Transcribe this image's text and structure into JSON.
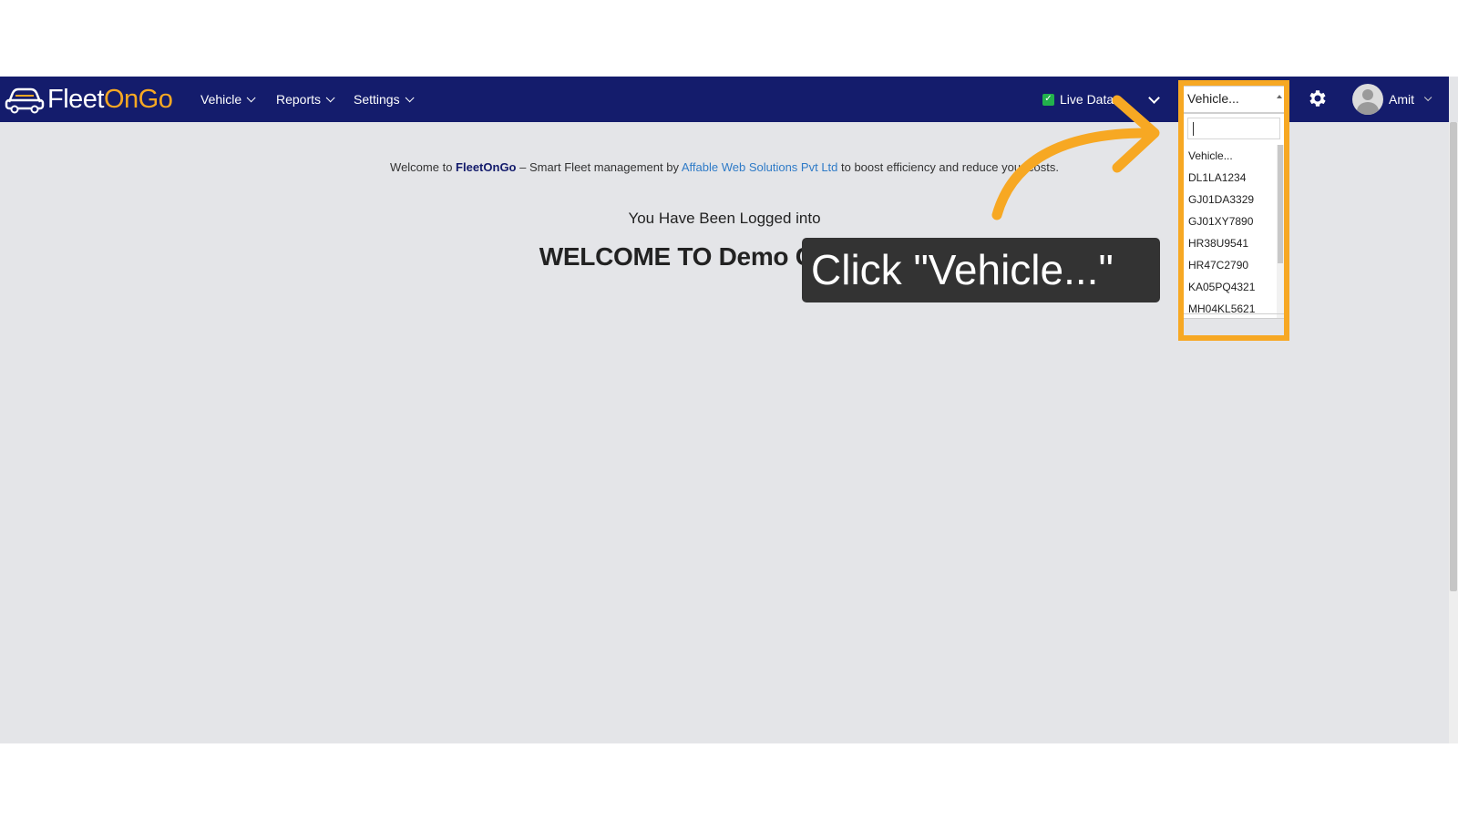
{
  "brand": {
    "name_part1": "Fleet",
    "name_part2": "OnGo",
    "logo_icon": "car-icon"
  },
  "nav": {
    "menus": [
      {
        "label": "Vehicle"
      },
      {
        "label": "Reports"
      },
      {
        "label": "Settings"
      }
    ],
    "live_data": {
      "label": "Live Data",
      "checked": true
    },
    "vehicle_select": {
      "value": "Vehicle...",
      "search_value": "",
      "options": [
        "Vehicle...",
        "DL1LA1234",
        "GJ01DA3329",
        "GJ01XY7890",
        "HR38U9541",
        "HR47C2790",
        "KA05PQ4321",
        "MH04KL5621"
      ]
    },
    "settings_icon": "gear-icon",
    "user": {
      "name": "Amit",
      "avatar_icon": "user-avatar-icon"
    }
  },
  "main": {
    "welcome": {
      "prefix": "Welcome to ",
      "brand": "FleetOnGo",
      "middle": " – Smart Fleet management by ",
      "company": "Affable Web Solutions Pvt Ltd",
      "suffix": " to boost efficiency and reduce your costs."
    },
    "logged_in_text": "You Have Been Logged into",
    "company_title": "WELCOME TO Demo Company"
  },
  "overlay": {
    "instruction": "Click \"Vehicle...\"",
    "highlight_color": "#f7a823",
    "arrow_color": "#f7a823"
  },
  "colors": {
    "navbar": "#141c6c",
    "accent": "#f7a823",
    "link": "#2f7bc7",
    "background": "#e4e5e8"
  }
}
